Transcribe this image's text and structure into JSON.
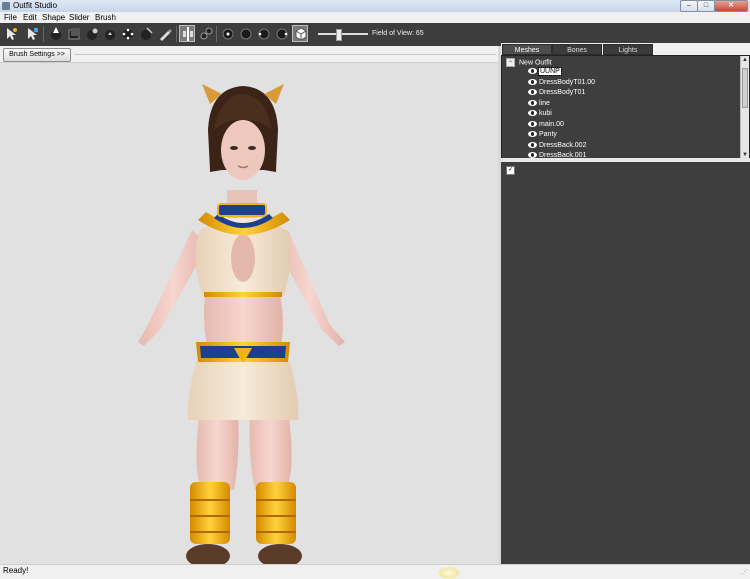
{
  "window": {
    "title": "Outfit Studio",
    "buttons": {
      "minimize": "–",
      "maximize": "□",
      "close": "✕"
    }
  },
  "menu": [
    "File",
    "Edit",
    "Shape",
    "Slider",
    "Brush"
  ],
  "toolbar": {
    "icons": [
      "select-tool-icon",
      "transform-tool-icon",
      "brush-mask-icon",
      "brush-inflate-icon",
      "brush-deflate-icon",
      "brush-move-icon",
      "brush-smooth-icon",
      "brush-weight-icon",
      "brush-color-icon",
      "mirror-x-icon",
      "connected-only-icon",
      "view-front-icon",
      "view-back-icon",
      "view-left-icon",
      "view-right-icon",
      "view-perspective-icon"
    ],
    "field_of_view": {
      "label": "Field of View: 65",
      "value": 65,
      "min": 0,
      "max": 160
    }
  },
  "viewport": {
    "brush_settings_label": "Brush Settings >>"
  },
  "right_panel": {
    "tabs": [
      "Meshes",
      "Bones",
      "Lights"
    ],
    "active_tab": "Meshes",
    "tree_root": "New Outfit",
    "meshes": [
      "UUNP",
      "DressBodyT01.00",
      "DressBodyT01",
      "line",
      "kubi",
      "main.00",
      "Panty",
      "DressBack.002",
      "DressBack.001"
    ],
    "selected_mesh": "UUNP"
  },
  "status": {
    "text": "Ready!"
  },
  "colors": {
    "toolbar_bg": "#3d3d3d",
    "panel_bg": "#3e3e3e",
    "viewport_bg": "#e1e1e1",
    "outfit_gold": "#f0b21a",
    "outfit_blue": "#1c3f8f",
    "outfit_cream": "#efe0c8"
  }
}
